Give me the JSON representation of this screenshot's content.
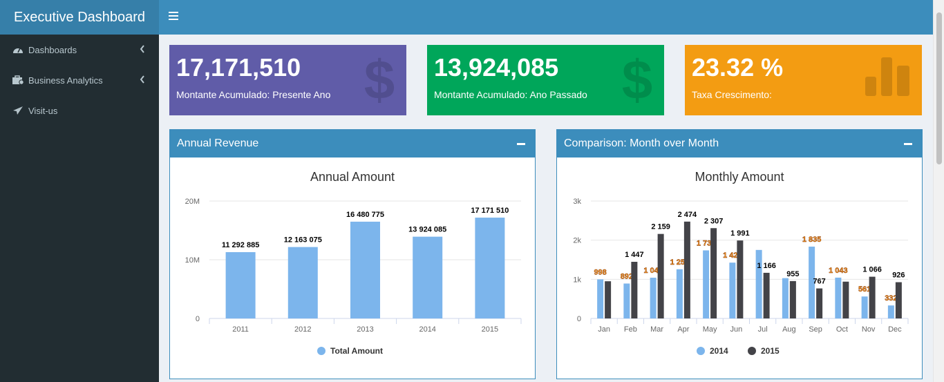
{
  "app": {
    "title": "Executive Dashboard"
  },
  "sidebar": {
    "items": [
      {
        "label": "Dashboards",
        "icon": "tachometer-icon"
      },
      {
        "label": "Business Analytics",
        "icon": "briefcase-icon"
      },
      {
        "label": "Visit-us",
        "icon": "paper-plane-icon"
      }
    ]
  },
  "infoboxes": [
    {
      "value": "17,171,510",
      "label": "Montante Acumulado: Presente Ano",
      "color": "#605ca8",
      "icon": "dollar-icon"
    },
    {
      "value": "13,924,085",
      "label": "Montante Acumulado: Ano Passado",
      "color": "#00a65a",
      "icon": "dollar-icon"
    },
    {
      "value": "23.32 %",
      "label": "Taxa Crescimento:",
      "color": "#f39c12",
      "icon": "bar-chart-icon"
    }
  ],
  "boxes": {
    "annual": {
      "title": "Annual Revenue"
    },
    "monthly": {
      "title": "Comparison: Month over Month"
    }
  },
  "colors": {
    "series1": "#7cb5ec",
    "series2": "#434348",
    "accent": "#3c8dbc"
  },
  "chart_data": [
    {
      "type": "bar",
      "title": "Annual Amount",
      "categories": [
        "2011",
        "2012",
        "2013",
        "2014",
        "2015"
      ],
      "series": [
        {
          "name": "Total Amount",
          "values": [
            11292885,
            12163075,
            16480775,
            13924085,
            17171510
          ]
        }
      ],
      "data_labels": [
        "11 292 885",
        "12 163 075",
        "16 480 775",
        "13 924 085",
        "17 171 510"
      ],
      "yticks": [
        "0",
        "10M",
        "20M"
      ],
      "ylim": [
        0,
        20000000
      ],
      "grid": true,
      "legend": "bottom-center"
    },
    {
      "type": "bar",
      "title": "Monthly Amount",
      "categories": [
        "Jan",
        "Feb",
        "Mar",
        "Apr",
        "May",
        "Jun",
        "Jul",
        "Aug",
        "Sep",
        "Oct",
        "Nov",
        "Dec"
      ],
      "series": [
        {
          "name": "2014",
          "values": [
            998,
            892,
            1041,
            1257,
            1739,
            1426,
            1750,
            1030,
            1835,
            1043,
            561,
            332
          ],
          "data_labels": [
            "998",
            "892",
            "1 041",
            "1 257",
            "1 739",
            "1 426",
            "",
            "",
            "1 835",
            "1 043",
            "561",
            "332"
          ]
        },
        {
          "name": "2015",
          "values": [
            950,
            1447,
            2159,
            2474,
            2307,
            1991,
            1166,
            955,
            767,
            940,
            1066,
            926
          ],
          "data_labels": [
            "",
            "1 447",
            "2 159",
            "2 474",
            "2 307",
            "1 991",
            "1 166",
            "955",
            "767",
            "",
            "1 066",
            "926"
          ]
        }
      ],
      "yticks": [
        "0",
        "1k",
        "2k",
        "3k"
      ],
      "ylim": [
        0,
        3000
      ],
      "grid": true,
      "legend": "bottom-center"
    }
  ]
}
